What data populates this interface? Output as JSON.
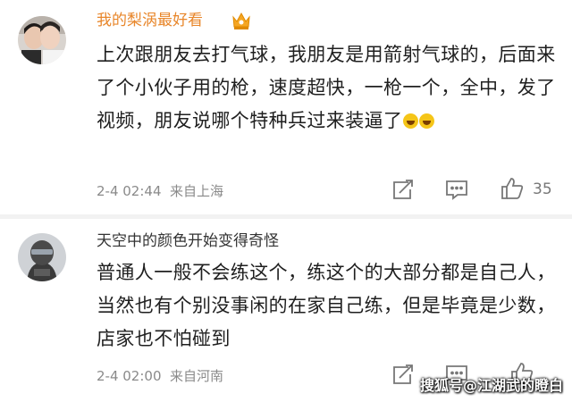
{
  "comments": [
    {
      "username": "我的梨涡最好看",
      "text": "上次跟朋友去打气球，我朋友是用箭射气球的，后面来了个小伙子用的枪，速度超快，一枪一个，全中，发了视频，朋友说哪个特种兵过来装逼了",
      "emoji": "laugh-cry-icon",
      "timestamp": "2-4 02:44",
      "location": "来自上海",
      "likes": "35",
      "username_color": "#e8862a"
    },
    {
      "username": "天空中的颜色开始变得奇怪",
      "text": "普通人一般不会练这个，练这个的大部分都是自己人，当然也有个别没事闲的在家自己练，但是毕竟是少数，店家也不怕碰到",
      "timestamp": "2-4 02:00",
      "location": "来自河南",
      "likes": ""
    }
  ],
  "watermark": "搜狐号@江湖武的瞪白"
}
